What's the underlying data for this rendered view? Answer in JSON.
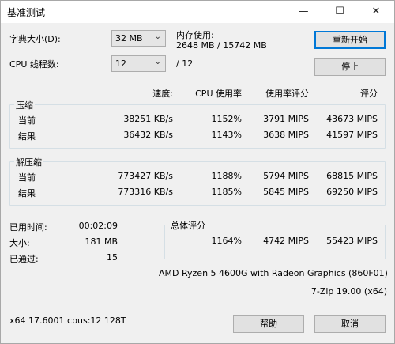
{
  "window": {
    "title": "基准测试",
    "minimize": "—",
    "maximize": "☐",
    "close": "✕"
  },
  "dict": {
    "label": "字典大小(D):",
    "value": "32 MB"
  },
  "threads": {
    "label": "CPU 线程数:",
    "value": "12",
    "suffix": "/ 12"
  },
  "memory": {
    "label": "内存使用:",
    "value": "2648 MB / 15742 MB"
  },
  "buttons": {
    "restart": "重新开始",
    "stop": "停止",
    "help": "帮助",
    "cancel": "取消"
  },
  "headers": {
    "speed": "速度:",
    "cpu": "CPU 使用率",
    "rating": "使用率评分",
    "score": "评分"
  },
  "compress": {
    "label": "压缩",
    "current": {
      "label": "当前",
      "speed": "38251 KB/s",
      "cpu": "1152%",
      "rating": "3791 MIPS",
      "score": "43673 MIPS"
    },
    "result": {
      "label": "结果",
      "speed": "36432 KB/s",
      "cpu": "1143%",
      "rating": "3638 MIPS",
      "score": "41597 MIPS"
    }
  },
  "decompress": {
    "label": "解压缩",
    "current": {
      "label": "当前",
      "speed": "773427 KB/s",
      "cpu": "1188%",
      "rating": "5794 MIPS",
      "score": "68815 MIPS"
    },
    "result": {
      "label": "结果",
      "speed": "773316 KB/s",
      "cpu": "1185%",
      "rating": "5845 MIPS",
      "score": "69250 MIPS"
    }
  },
  "stats": {
    "elapsed": {
      "label": "已用时间:",
      "value": "00:02:09"
    },
    "size": {
      "label": "大小:",
      "value": "181 MB"
    },
    "passes": {
      "label": "已通过:",
      "value": "15"
    }
  },
  "total": {
    "label": "总体评分",
    "cpu": "1164%",
    "rating": "4742 MIPS",
    "score": "55423 MIPS"
  },
  "cpu_name": "AMD Ryzen 5 4600G with Radeon Graphics (860F01)",
  "version": "7-Zip 19.00 (x64)",
  "sysinfo": "x64 17.6001 cpus:12 128T"
}
